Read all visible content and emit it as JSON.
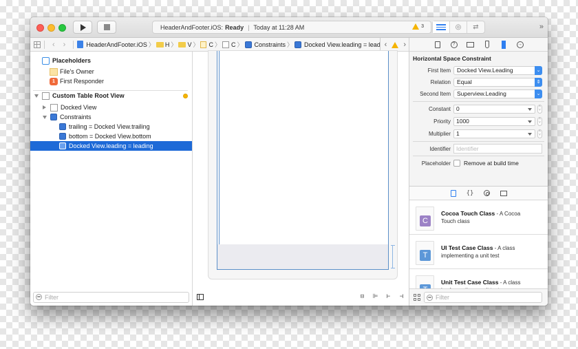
{
  "toolbar": {
    "run_icon": "play-icon",
    "stop_icon": "stop-icon",
    "activity": {
      "scheme": "HeaderAndFooter.iOS:",
      "status": "Ready",
      "timestamp": "Today at 11:28 AM",
      "warning_count": "3"
    },
    "editor_segments": [
      "standard-editor-icon",
      "assistant-editor-icon",
      "version-editor-icon"
    ],
    "overflow": "»"
  },
  "jumpbar": {
    "items": [
      "HeaderAndFooter.iOS",
      "H",
      "V",
      "C",
      "C",
      "Constraints",
      "Docked View.leading = leading"
    ],
    "nav_back": "‹",
    "nav_forward": "›"
  },
  "outline": {
    "placeholders_title": "Placeholders",
    "files_owner": "File's Owner",
    "first_responder": "First Responder",
    "root_view": "Custom Table Root View",
    "docked_view": "Docked View",
    "constraints": "Constraints",
    "constraint_items": [
      "trailing = Docked View.trailing",
      "bottom = Docked View.bottom",
      "Docked View.leading = leading"
    ],
    "filter_placeholder": "Filter"
  },
  "canvas": {
    "bottom_icons": [
      "embed-in-stack-icon",
      "align-icon",
      "pin-icon",
      "resolve-issues-icon"
    ]
  },
  "inspector": {
    "tabs": [
      "file-inspector-icon",
      "quick-help-icon",
      "identity-inspector-icon",
      "attributes-inspector-icon",
      "size-inspector-icon",
      "connections-inspector-icon"
    ],
    "active_tab": "size-inspector-icon",
    "section_title": "Horizontal Space Constraint",
    "first_item_label": "First Item",
    "first_item_value": "Docked View.Leading",
    "relation_label": "Relation",
    "relation_value": "Equal",
    "second_item_label": "Second Item",
    "second_item_value": "Superview.Leading",
    "constant_label": "Constant",
    "constant_value": "0",
    "priority_label": "Priority",
    "priority_value": "1000",
    "multiplier_label": "Multiplier",
    "multiplier_value": "1",
    "identifier_label": "Identifier",
    "identifier_placeholder": "Identifier",
    "placeholder_label": "Placeholder",
    "placeholder_checkbox_label": "Remove at build time",
    "placeholder_checked": false
  },
  "library": {
    "tabs": [
      "file-template-icon",
      "code-snippet-icon",
      "object-library-icon",
      "media-library-icon"
    ],
    "items": [
      {
        "badge": "C",
        "color": "#9c82c6",
        "title": "Cocoa Touch Class",
        "desc_inline": " - A Cocoa",
        "desc_line2": "Touch class"
      },
      {
        "badge": "T",
        "color": "#5c97d8",
        "title": "UI Test Case Class",
        "desc_inline": " - A class",
        "desc_line2": "implementing a unit test"
      },
      {
        "badge": "T",
        "color": "#5c97d8",
        "title": "Unit Test Case Class",
        "desc_inline": " - A class",
        "desc_line2": "implementing a unit test"
      }
    ],
    "filter_placeholder": "Filter"
  }
}
